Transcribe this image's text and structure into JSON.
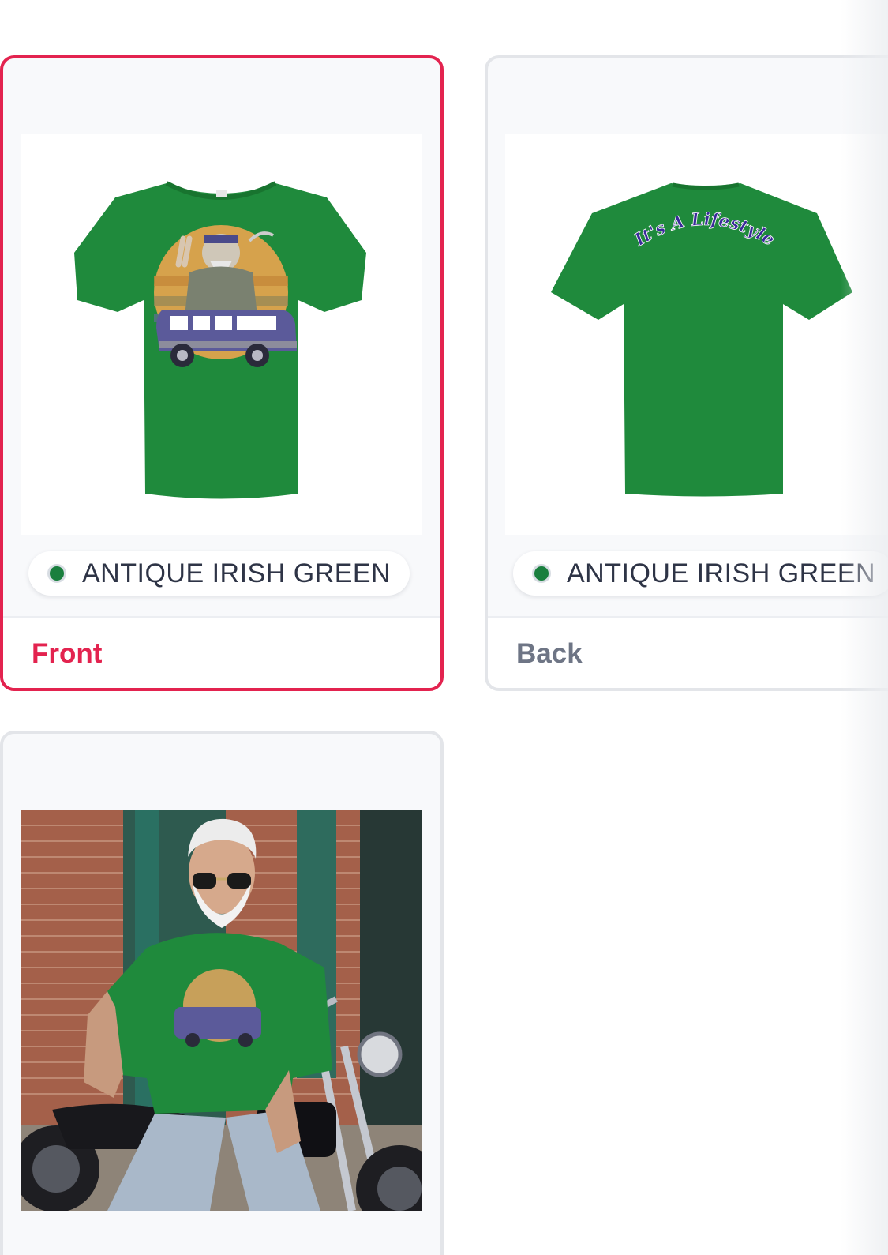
{
  "colors": {
    "accent": "#e3234f",
    "shirt_green": "#1f8a3c",
    "swatch_green": "#1a7f3e",
    "text_dark": "#2e3446",
    "text_muted": "#6e7585"
  },
  "views": [
    {
      "label": "Front",
      "selected": true,
      "color_name": "ANTIQUE IRISH GREEN"
    },
    {
      "label": "Back",
      "selected": false,
      "color_name": "ANTIQUE IRISH GREEN",
      "print_text": "It's A Lifestyle"
    },
    {
      "label": "",
      "selected": false
    }
  ]
}
